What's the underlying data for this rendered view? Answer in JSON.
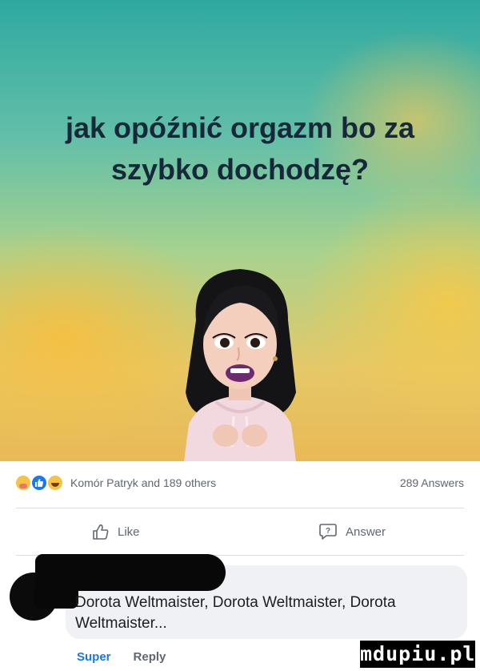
{
  "post": {
    "question": "jak opóźnić orgazm bo za szybko dochodzę?",
    "background_colors": [
      "#2fa9a0",
      "#a8d28f",
      "#e9b955"
    ]
  },
  "stats": {
    "reaction_icons": [
      "care-icon",
      "like-icon",
      "haha-icon"
    ],
    "reactors": "Komór Patryk and 189 others",
    "answers": "289 Answers"
  },
  "actions": {
    "like": "Like",
    "answer": "Answer"
  },
  "comment": {
    "text": "Dorota Weltmaister, Dorota Weltmaister, Dorota Weltmaister...",
    "super": "Super",
    "reply": "Reply"
  },
  "watermark": "mdupiu.pl",
  "colors": {
    "link_blue": "#1877f2",
    "secondary_text": "#606770",
    "bubble": "#eff1f4"
  }
}
